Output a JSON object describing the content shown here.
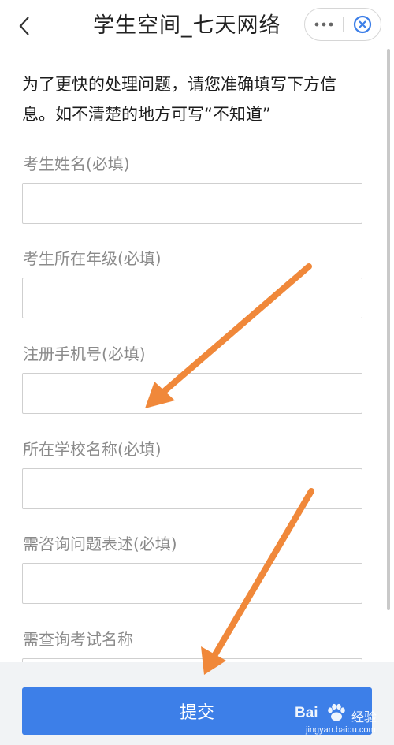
{
  "nav": {
    "title": "学生空间_七天网络",
    "back_icon": "chevron-left-icon",
    "more_icon": "more-horizontal-icon",
    "close_icon": "close-circle-icon"
  },
  "intro": "为了更快的处理问题，请您准确填写下方信息。如不清楚的地方可写“不知道”",
  "fields": [
    {
      "label": "考生姓名(必填)",
      "value": ""
    },
    {
      "label": "考生所在年级(必填)",
      "value": ""
    },
    {
      "label": "注册手机号(必填)",
      "value": ""
    },
    {
      "label": "所在学校名称(必填)",
      "value": ""
    },
    {
      "label": "需咨询问题表述(必填)",
      "value": ""
    },
    {
      "label": "需查询考试名称",
      "value": ""
    }
  ],
  "submit_label": "提交",
  "watermark": {
    "brand": "Bai",
    "text": "经验",
    "url": "jingyan.baidu.com"
  },
  "colors": {
    "accent": "#3d7fe8",
    "arrow": "#f0883a",
    "label": "#8a8a8a",
    "close_icon": "#3d7fe8"
  }
}
